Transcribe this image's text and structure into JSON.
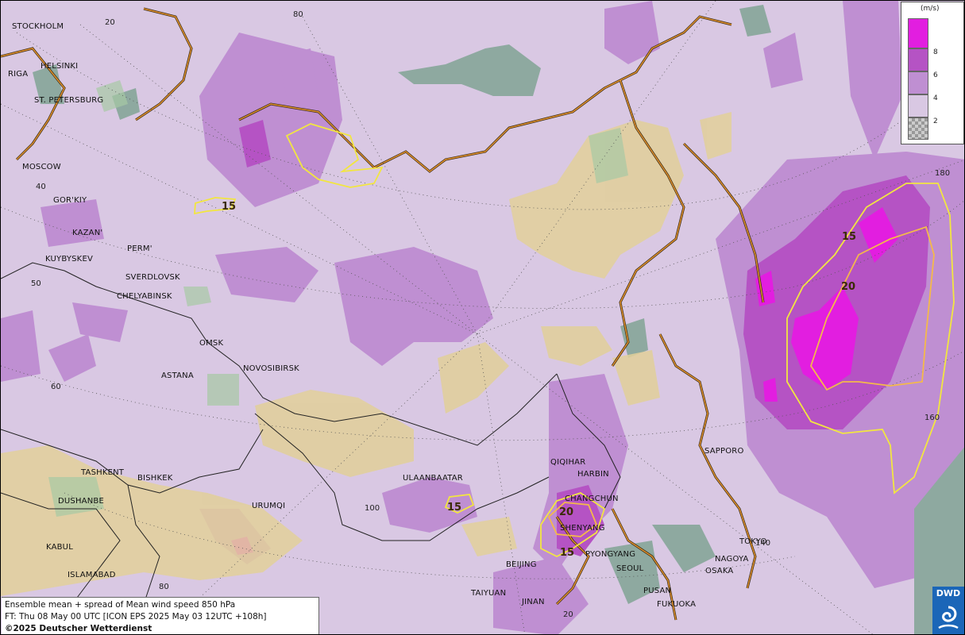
{
  "colors": {
    "base": "#d9c8e3",
    "level4": "#d9c8e3",
    "level6": "#bf8fd2",
    "level8": "#b553c4",
    "level10": "#e21ee0",
    "sea_grey": "#8ea9a0",
    "coast": "#e0902e",
    "border": "#222222",
    "contour15": "#f2e640",
    "contour20": "#f4b94a",
    "dwd_blue": "#1b66b8"
  },
  "legend": {
    "unit": "(m/s)",
    "ticks": [
      "8",
      "6",
      "4",
      "2"
    ]
  },
  "cities": [
    {
      "name": "STOCKHOLM"
    },
    {
      "name": "HELSINKI"
    },
    {
      "name": "RIGA"
    },
    {
      "name": "ST. PETERSBURG"
    },
    {
      "name": "MOSCOW"
    },
    {
      "name": "GOR'KIY"
    },
    {
      "name": "KAZAN'"
    },
    {
      "name": "PERM'"
    },
    {
      "name": "KUYBYSKEV"
    },
    {
      "name": "SVERDLOVSK"
    },
    {
      "name": "CHELYABINSK"
    },
    {
      "name": "OMSK"
    },
    {
      "name": "ASTANA"
    },
    {
      "name": "NOVOSIBIRSK"
    },
    {
      "name": "TASHKENT"
    },
    {
      "name": "BISHKEK"
    },
    {
      "name": "DUSHANBE"
    },
    {
      "name": "URUMQI"
    },
    {
      "name": "KABUL"
    },
    {
      "name": "ISLAMABAD"
    },
    {
      "name": "ULAANBAATAR"
    },
    {
      "name": "QIQIHAR"
    },
    {
      "name": "HARBIN"
    },
    {
      "name": "CHANGCHUN"
    },
    {
      "name": "SHENYANG"
    },
    {
      "name": "PYONGYANG"
    },
    {
      "name": "SEOUL"
    },
    {
      "name": "BEIJING"
    },
    {
      "name": "TAIYUAN"
    },
    {
      "name": "JINAN"
    },
    {
      "name": "PUSAN"
    },
    {
      "name": "FUKUOKA"
    },
    {
      "name": "OSAKA"
    },
    {
      "name": "NAGOYA"
    },
    {
      "name": "TOKYO"
    },
    {
      "name": "SAPPORO"
    }
  ],
  "grid_labels": [
    "20",
    "80",
    "40",
    "50",
    "60",
    "100",
    "80",
    "20",
    "180",
    "160",
    "140"
  ],
  "contour_labels": [
    "15",
    "15",
    "20",
    "15",
    "20",
    "15"
  ],
  "info": {
    "line1": "Ensemble mean + spread of Mean wind speed 850 hPa",
    "line2": "FT: Thu 08 May 00 UTC [ICON EPS 2025 May 03 12UTC +108h]",
    "line3": "©2025 Deutscher Wetterdienst"
  },
  "logo": {
    "text": "DWD"
  }
}
